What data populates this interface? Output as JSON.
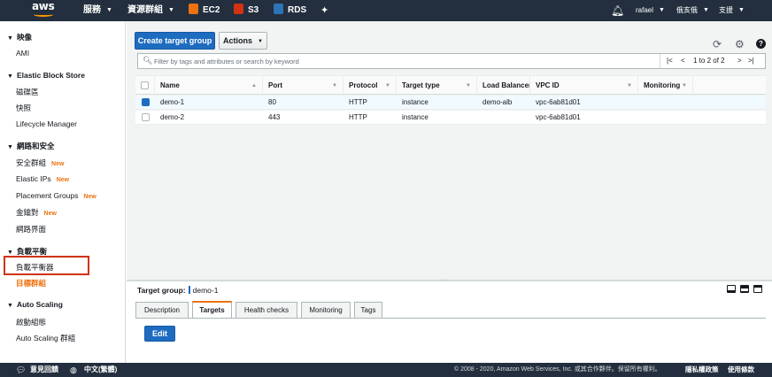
{
  "topnav": {
    "logo": "aws",
    "services": "服務",
    "resource_groups": "資源群組",
    "shortcuts": [
      {
        "label": "EC2",
        "color": "#ec7211",
        "icon": "ec2-icon"
      },
      {
        "label": "S3",
        "color": "#d13212",
        "icon": "s3-icon"
      },
      {
        "label": "RDS",
        "color": "#2e73b8",
        "icon": "rds-icon"
      }
    ],
    "user": "rafael",
    "region": "俄亥俄",
    "support": "支援"
  },
  "sidebar": {
    "sections": [
      {
        "title": "映像",
        "items": [
          {
            "label": "AMI"
          }
        ]
      },
      {
        "title": "Elastic Block Store",
        "items": [
          {
            "label": "磁碟區"
          },
          {
            "label": "快照"
          },
          {
            "label": "Lifecycle Manager"
          }
        ]
      },
      {
        "title": "網路和安全",
        "items": [
          {
            "label": "安全群組",
            "badge": "New"
          },
          {
            "label": "Elastic IPs",
            "badge": "New"
          },
          {
            "label": "Placement Groups",
            "badge": "New"
          },
          {
            "label": "金鑰對",
            "badge": "New"
          },
          {
            "label": "網路界面"
          }
        ]
      },
      {
        "title": "負載平衡",
        "items": [
          {
            "label": "負載平衡器"
          },
          {
            "label": "目標群組",
            "active": true
          }
        ]
      },
      {
        "title": "Auto Scaling",
        "items": [
          {
            "label": "啟動組態"
          },
          {
            "label": "Auto Scaling 群組"
          }
        ]
      }
    ]
  },
  "toolbar": {
    "create_label": "Create target group",
    "actions_label": "Actions"
  },
  "filter": {
    "placeholder": "Filter by tags and attributes or search by keyword",
    "pagination": "1 to 2 of 2"
  },
  "table": {
    "columns": [
      "Name",
      "Port",
      "Protocol",
      "Target type",
      "Load Balancer",
      "VPC ID",
      "Monitoring"
    ],
    "rows": [
      {
        "selected": true,
        "name": "demo-1",
        "port": "80",
        "protocol": "HTTP",
        "target_type": "instance",
        "load_balancer": "demo-alb",
        "vpc_id": "vpc-6ab81d01",
        "monitoring": ""
      },
      {
        "selected": false,
        "name": "demo-2",
        "port": "443",
        "protocol": "HTTP",
        "target_type": "instance",
        "load_balancer": "",
        "vpc_id": "vpc-6ab81d01",
        "monitoring": ""
      }
    ]
  },
  "detail": {
    "label": "Target group:",
    "value": "demo-1",
    "tabs": [
      "Description",
      "Targets",
      "Health checks",
      "Monitoring",
      "Tags"
    ],
    "active_tab": "Targets",
    "edit_label": "Edit"
  },
  "footer": {
    "feedback": "意見回饋",
    "language": "中文(繁體)",
    "copyright": "© 2008 - 2020, Amazon Web Services, Inc. 或其合作夥伴。保留所有權利。",
    "privacy": "隱私權政策",
    "terms": "使用條款"
  },
  "colors": {
    "nav": "#232f3e",
    "primary": "#1e6cc0",
    "accent": "#ec7211",
    "highlight": "#d13212"
  }
}
